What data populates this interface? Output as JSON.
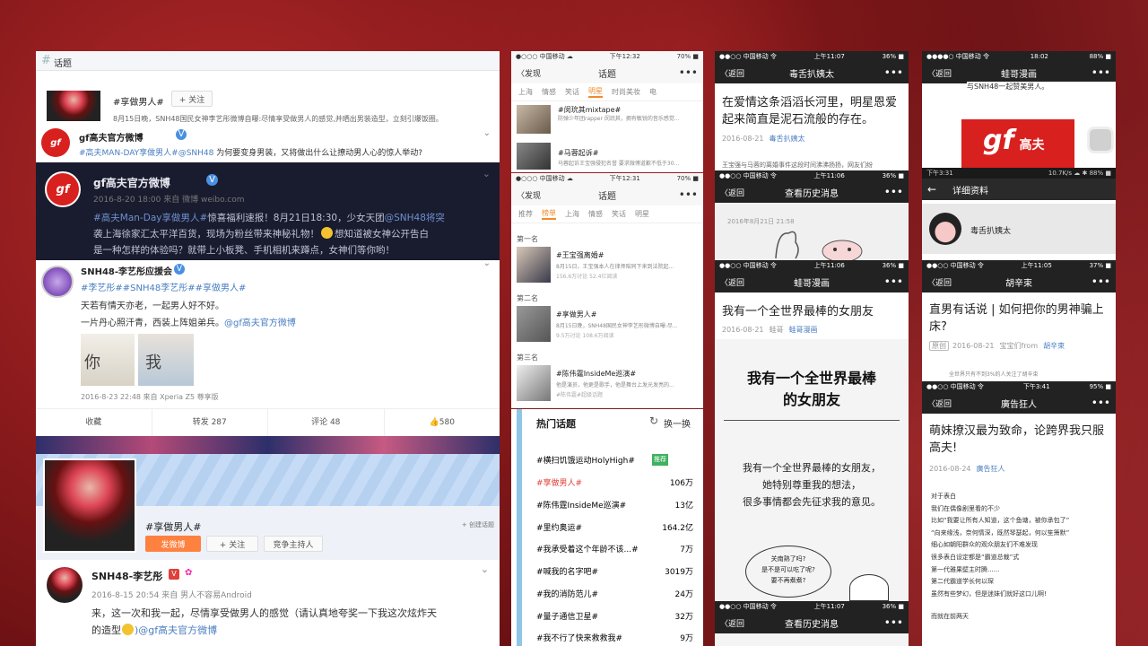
{
  "panelA": {
    "header": "话题",
    "topic1": {
      "name": "#享做男人#",
      "follow": "+ 关注",
      "desc": "8月15日晚，SNH48国民女神李艺彤微博自曝:尽情享受做男人的感觉,并晒出男装造型，立刻引爆饭圈。"
    },
    "gf1": {
      "name": "gf高夫官方微博",
      "text_tag": "#高夫MAN-DAY享做男人#",
      "text_at": "@SNH48",
      "text_rest": " 为何要变身男装，又将做出什么让撩动男人心的惊人举动?"
    },
    "dark": {
      "name": "gf高夫官方微博",
      "time": "2016-8-20 18:00 来自 微博 weibo.com",
      "line1_tag": "#高夫Man-Day享做男人#",
      "line1_rest": "惊喜福利速报！8月21日18:30，少女天团",
      "line1_at": "@SNH48将突",
      "line2": "袭上海徐家汇太平洋百货，现场为粉丝带来神秘礼物！",
      "line2b": "想知道被女神公开告白",
      "line3": "是一种怎样的体验吗？就带上小板凳、手机相机来蹲点，女神们等你哟！"
    },
    "post": {
      "name": "SNH48-李艺彤应援会",
      "tags": "#李艺彤##SNH48李艺彤##享做男人#",
      "line1": "天若有情天亦老，一起男人好不好。",
      "line2": "一片丹心照汗青，西装上阵姐弟兵。",
      "at": "@gf高夫官方微博",
      "img1": "你",
      "img2": "我",
      "time": "2016-8-23 22:48 来自 Xperia Z5 尊享版",
      "actions": [
        "收藏",
        "转发 287",
        "评论 48",
        "580"
      ]
    },
    "topicCard": {
      "title": "#享做男人#",
      "create": "+ 创建话题",
      "publish": "发微博",
      "follow": "+ 关注",
      "compete": "竞争主持人"
    },
    "user": {
      "name": "SNH48-李艺彤",
      "time": "2016-8-15 20:54 来自 男人不容易Android",
      "line1": "来，这一次和我一起，尽情享受做男人的感觉（请认真地夸奖一下我这次炫炸天",
      "line2": "的造型",
      "at": ")@gf高夫官方微博"
    }
  },
  "phone1": {
    "carrier": "●○○○ 中国移动 ☁",
    "time": "下午12:32",
    "battery": "70% ■",
    "back": "〈发现",
    "title": "话题",
    "more": "•••",
    "tabs": [
      "上海",
      "情感",
      "笑话",
      "明星",
      "时尚美妆",
      "电"
    ],
    "items": [
      {
        "t": "#闵玧其mixtape#",
        "d": "防弹少年团rapper 闵玧其，拥有敏锐的音乐感觉..."
      },
      {
        "t": "#马蓉起诉#",
        "d": "马蓉起诉王宝强侵犯名誉 要求微博道歉不低于30..."
      }
    ]
  },
  "phone2": {
    "carrier": "●○○○ 中国移动 ☁",
    "time": "下午12:31",
    "battery": "70% ■",
    "back": "〈发现",
    "title": "话题",
    "more": "•••",
    "tabs": [
      "推荐",
      "榜单",
      "上海",
      "情感",
      "笑话",
      "明星"
    ],
    "rank": [
      {
        "label": "第一名",
        "t": "#王宝强离婚#",
        "d": "8月15日，王宝强本人在律师陪同下来到法院起...",
        "s": "156.6万讨论  52.4亿阅读"
      },
      {
        "label": "第二名",
        "t": "#享做男人#",
        "d": "8月15日晚，SNH48国民女神李艺彤微博自曝:尽...",
        "s": "9.5万讨论  108.6万阅读"
      },
      {
        "label": "第三名",
        "t": "#陈伟霆InsideMe巡演#",
        "d": "他是演员，他更是歌手，他是舞台上发光发亮的...",
        "s": "#陈伟霆#超级话题"
      }
    ]
  },
  "hot": {
    "title": "热门话题",
    "refresh": "换一换",
    "rows": [
      {
        "t": "#横扫饥饿运动HolyHigh#",
        "v": "推荐"
      },
      {
        "t": "#享做男人#",
        "v": "106万"
      },
      {
        "t": "#陈伟霆InsideMe巡演#",
        "v": "13亿"
      },
      {
        "t": "#里约奥运#",
        "v": "164.2亿"
      },
      {
        "t": "#我承受着这个年龄不该...#",
        "v": "7万"
      },
      {
        "t": "#喊我的名字吧#",
        "v": "3019万"
      },
      {
        "t": "#我的消防范儿#",
        "v": "24万"
      },
      {
        "t": "#量子通信卫星#",
        "v": "32万"
      },
      {
        "t": "#我不行了快来救救我#",
        "v": "9万"
      }
    ]
  },
  "p3a": {
    "carrier": "●●○○ 中国移动 令",
    "time": "上午11:07",
    "battery": "36% ■",
    "back": "〈返回",
    "title": "毒舌扒姨太",
    "more": "•••",
    "art": "在爱情这条滔滔长河里，明星恩爱起来简直是泥石流般的存在。",
    "date": "2016-08-21",
    "author": "毒舌扒姨太",
    "snippet": "王宝强与马蓉的离婚事件这段时间沸沸扬扬，网友们纷"
  },
  "p3b": {
    "carrier": "●●○○ 中国移动 令",
    "time": "上午11:06",
    "battery": "36% ■",
    "back": "〈返回",
    "title": "查看历史消息",
    "more": "•••",
    "date": "2016年8月21日 21:58"
  },
  "p3c": {
    "carrier": "●●○○ 中国移动 令",
    "time": "上午11:06",
    "battery": "36% ■",
    "back": "〈返回",
    "title": "蛙哥漫画",
    "more": "•••",
    "art": "我有一个全世界最棒的女朋友",
    "date": "2016-08-21",
    "author1": "蛙哥",
    "author2": "蛙哥漫画",
    "big": "我有一个全世界最棒的女朋友",
    "body1": "我有一个全世界最棒的女朋友，",
    "body2": "她特别尊重我的想法，",
    "body3": "很多事情都会先征求我的意见。",
    "bubble1": "关南熟了吗?",
    "bubble2": "是不是可以吃了呢?",
    "bubble3": "要不再煮煮?"
  },
  "p3d": {
    "carrier": "●●○○ 中国移动 令",
    "time": "上午11:07",
    "battery": "36% ■",
    "back": "〈返回",
    "title": "查看历史消息",
    "more": "•••"
  },
  "p4a": {
    "carrier": "●●●●○ 中国移动 令",
    "time": "18:02",
    "battery": "88% ■",
    "back": "〈返回",
    "title": "蛙哥漫画",
    "more": "•••",
    "intro": "与SNH48一起赞美男人。",
    "logo": "gf",
    "logoText": "高夫"
  },
  "p4b": {
    "carrier": "下午3:31",
    "time": "",
    "battery": "10.7K/s ☁ ✱ 88% ■",
    "back": "←",
    "title": "详细资料",
    "name": "毒舌扒姨太"
  },
  "p4c": {
    "carrier": "●●○○ 中国移动 令",
    "time": "上午11:05",
    "battery": "37% ■",
    "back": "〈返回",
    "title": "胡辛束",
    "more": "•••",
    "art": "直男有话说 | 如何把你的男神骗上床?",
    "orig": "原创",
    "date": "2016-08-21",
    "author1": "宝宝们from",
    "author2": "胡辛束",
    "snippet": "全世界只有不到3%的人关注了胡辛束"
  },
  "p4d": {
    "carrier": "●●○○ 中国移动 令",
    "time": "下午3:41",
    "battery": "95% ■",
    "back": "〈返回",
    "title": "廣告狂人",
    "more": "•••",
    "art": "萌妹撩汉最为致命，论跨界我只服高夫!",
    "date": "2016-08-24",
    "author": "廣告狂人",
    "lines": [
      "对于表白",
      "我们在偶像剧里看的不少",
      "比如“我要让所有人知道，这个鱼塘，被你承包了”",
      "“向来缘浅，奈何情深，既然琴瑟起，何以笙箫默”",
      "细心如朝阳群众的观众朋友们不难发现",
      "很多表白设定都是“霸道总裁”式",
      "第一代雅果壁主时腾......",
      "第二代霸道学长何以琛",
      "虽然有些梦幻，但是迷妹们就好这口儿啊!",
      "而就在前两天"
    ]
  },
  "colors": {
    "weiboBlue": "#4a7ec2",
    "accent": "#f28a2d",
    "red": "#e0403a"
  }
}
